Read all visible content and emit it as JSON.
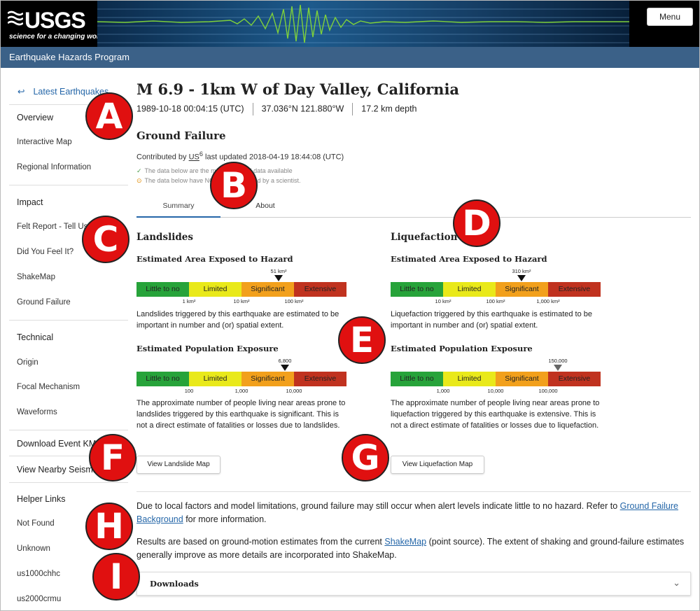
{
  "header": {
    "logo_word": "USGS",
    "logo_tagline": "science for a changing world",
    "menu_label": "Menu"
  },
  "program_bar": {
    "label": "Earthquake Hazards Program"
  },
  "sidebar": {
    "back_label": "Latest Earthquakes",
    "groups": [
      {
        "items": [
          "Overview",
          "Interactive Map",
          "Regional Information"
        ]
      },
      {
        "items": [
          "Impact",
          "Felt Report - Tell Us!",
          "Did You Feel It?",
          "ShakeMap",
          "Ground Failure"
        ]
      },
      {
        "items": [
          "Technical",
          "Origin",
          "Focal Mechanism",
          "Waveforms"
        ]
      },
      {
        "items": [
          "Download Event KML"
        ]
      },
      {
        "items": [
          "View Nearby Seismicity"
        ]
      },
      {
        "items": [
          "Helper Links",
          "Not Found",
          "Unknown",
          "us1000chhc",
          "us2000crmu"
        ]
      }
    ]
  },
  "event": {
    "title": "M 6.9 - 1km W of Day Valley, California",
    "time": "1989-10-18 00:04:15 (UTC)",
    "location": "37.036°N 121.880°W",
    "depth": "17.2 km depth"
  },
  "product": {
    "title": "Ground Failure",
    "contributed_prefix": "Contributed by",
    "source": "US",
    "source_sup": "6",
    "updated": "last updated 2018-04-19 18:44:08 (UTC)",
    "note1": "The data below are the most preferred data available",
    "note2": "The data below have NOT been reviewed by a scientist."
  },
  "tabs": [
    "Summary",
    "About"
  ],
  "levels": [
    "Little to no",
    "Limited",
    "Significant",
    "Extensive"
  ],
  "colors": {
    "green": "#27a33a",
    "yellow": "#e9e91a",
    "orange": "#f2a01c",
    "red": "#c0321f",
    "link": "#2466a8",
    "annotation": "#e01010"
  },
  "landslides": {
    "title": "Landslides",
    "area": {
      "title": "Estimated Area Exposed to Hazard",
      "value": "51 km²",
      "ticks": [
        "1 km²",
        "10 km²",
        "100 km²"
      ],
      "text": "Landslides triggered by this earthquake are estimated to be important in number and (or) spatial extent."
    },
    "population": {
      "title": "Estimated Population Exposure",
      "value": "6,800",
      "ticks": [
        "100",
        "1,000",
        "10,000"
      ],
      "text": "The approximate number of people living near areas prone to landslides triggered by this earthquake is significant. This is not a direct estimate of fatalities or losses due to landslides."
    },
    "button": "View Landslide Map"
  },
  "liquefaction": {
    "title": "Liquefaction",
    "area": {
      "title": "Estimated Area Exposed to Hazard",
      "value": "310 km²",
      "ticks": [
        "10 km²",
        "100 km²",
        "1,000 km²"
      ],
      "text": "Liquefaction triggered by this earthquake is estimated to be important in number and (or) spatial extent."
    },
    "population": {
      "title": "Estimated Population Exposure",
      "value": "150,000",
      "ticks": [
        "1,000",
        "10,000",
        "100,000"
      ],
      "text": "The approximate number of people living near areas prone to liquefaction triggered by this earthquake is extensive. This is not a direct estimate of fatalities or losses due to liquefaction."
    },
    "button": "View Liquefaction Map"
  },
  "footer": {
    "p1_before": "Due to local factors and model limitations, ground failure may still occur when alert levels indicate little to no hazard. Refer to",
    "p1_link": "Ground Failure Background",
    "p1_after": "for more information.",
    "p2_before": "Results are based on ground-motion estimates from the current",
    "p2_link": "ShakeMap",
    "p2_after": "(point source). The extent of shaking and ground-failure estimates generally improve as more details are incorporated into ShakeMap.",
    "downloads": "Downloads"
  },
  "annotations": [
    "A",
    "B",
    "C",
    "D",
    "E",
    "F",
    "G",
    "H",
    "I"
  ]
}
